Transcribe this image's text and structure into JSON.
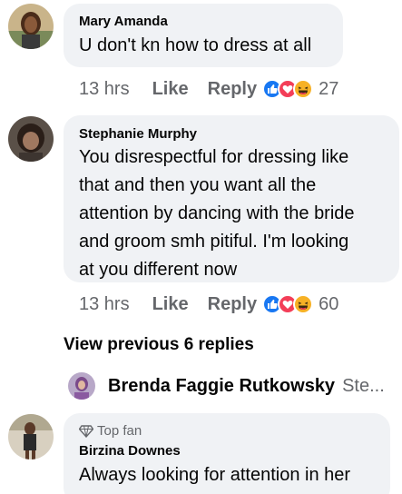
{
  "colors": {
    "bubble": "#f0f2f5",
    "meta": "#65676b",
    "like_blue": "#1877f2",
    "love_red": "#f33e58",
    "haha_yellow": "#f7b125"
  },
  "comments": [
    {
      "author": "Mary Amanda",
      "text": "U don't kn how to dress at all",
      "time": "13 hrs",
      "like_label": "Like",
      "reply_label": "Reply",
      "reaction_icons": [
        "like-icon",
        "love-icon",
        "haha-icon"
      ],
      "reaction_count": "27"
    },
    {
      "author": "Stephanie Murphy",
      "text_lines": [
        "You  disrespectful for dressing like",
        "that and then you want all the",
        "attention by dancing with the bride",
        "and groom  smh pitiful.  I'm looking",
        "at you different now"
      ],
      "time": "13 hrs",
      "like_label": "Like",
      "reply_label": "Reply",
      "reaction_icons": [
        "like-icon",
        "love-icon",
        "haha-icon"
      ],
      "reaction_count": "60"
    }
  ],
  "view_previous": "View previous 6 replies",
  "nested_reply": {
    "author": "Brenda Faggie Rutkowsky",
    "preview": "Ste..."
  },
  "last_comment": {
    "badge": "Top fan",
    "author": "Birzina Downes",
    "text": "Always looking for attention in her"
  }
}
